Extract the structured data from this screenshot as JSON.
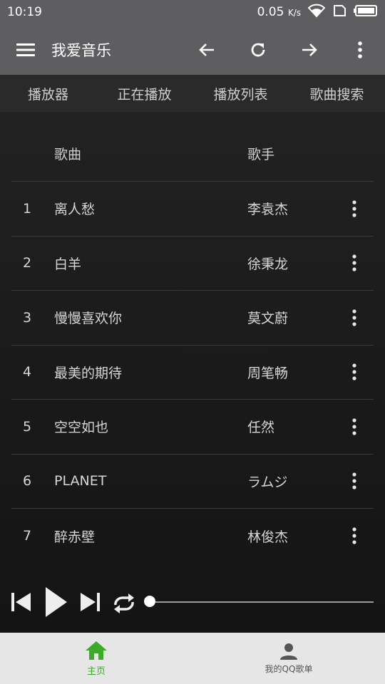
{
  "status": {
    "time": "10:19",
    "speed": "0.05",
    "speed_unit": "K/s"
  },
  "appbar": {
    "title": "我爱音乐"
  },
  "tabs": [
    {
      "label": "播放器"
    },
    {
      "label": "正在播放"
    },
    {
      "label": "播放列表"
    },
    {
      "label": "歌曲搜索"
    }
  ],
  "table": {
    "col_song": "歌曲",
    "col_artist": "歌手",
    "rows": [
      {
        "index": "1",
        "song": "离人愁",
        "artist": "李袁杰"
      },
      {
        "index": "2",
        "song": "白羊",
        "artist": "徐秉龙"
      },
      {
        "index": "3",
        "song": "慢慢喜欢你",
        "artist": "莫文蔚"
      },
      {
        "index": "4",
        "song": "最美的期待",
        "artist": "周笔畅"
      },
      {
        "index": "5",
        "song": "空空如也",
        "artist": "任然"
      },
      {
        "index": "6",
        "song": "PLANET",
        "artist": "ラムジ"
      },
      {
        "index": "7",
        "song": "醉赤壁",
        "artist": "林俊杰"
      }
    ]
  },
  "player": {
    "progress": 0
  },
  "bottomnav": {
    "home_label": "主页",
    "qq_label": "我的QQ歌单",
    "home_color": "#3daa2a",
    "qq_color": "#555555"
  },
  "colors": {
    "appbar": "#5e5d60",
    "background": "#1c1c1c"
  }
}
